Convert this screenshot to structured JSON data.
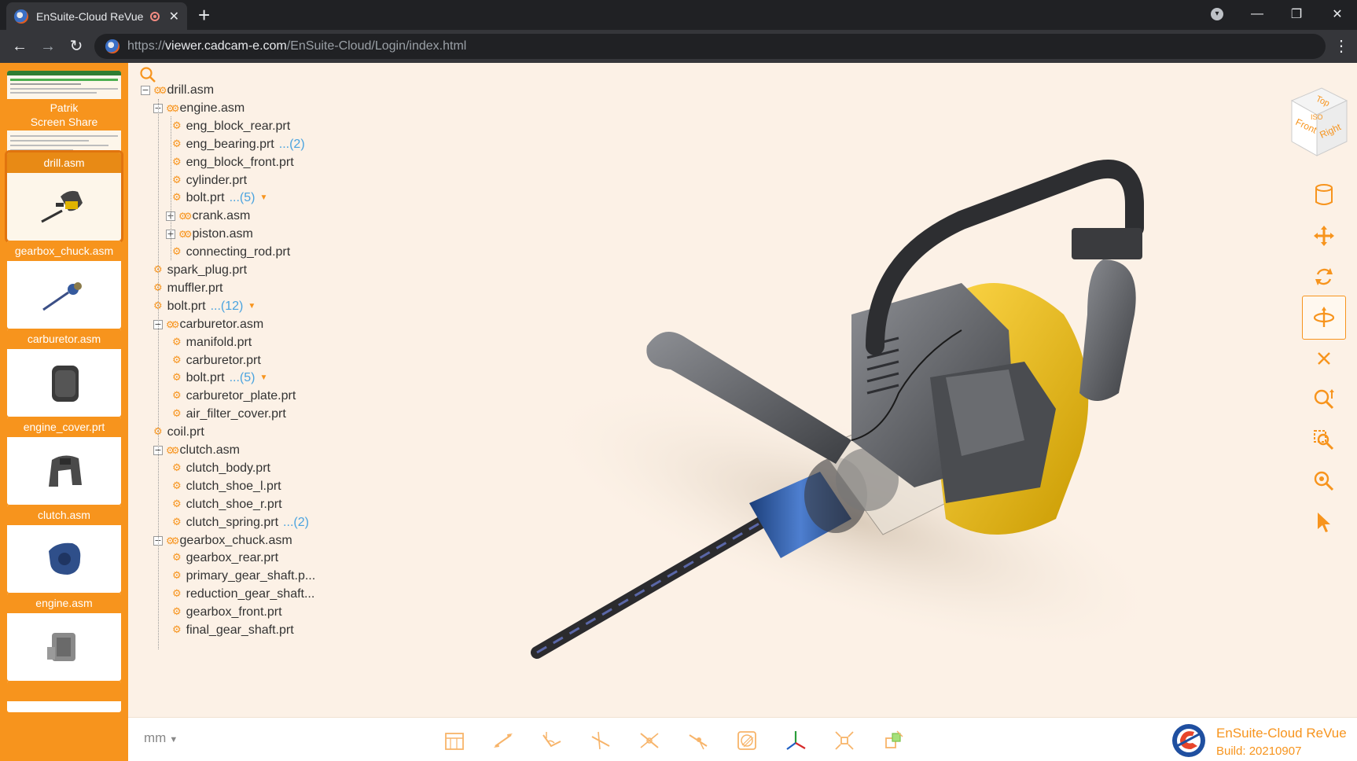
{
  "browser": {
    "tab_title": "EnSuite-Cloud ReVue",
    "url_scheme": "https://",
    "url_host": "viewer.cadcam-e.com",
    "url_path": "/EnSuite-Cloud/Login/index.html"
  },
  "sidebar": {
    "share": {
      "name": "Patrik",
      "caption": "Screen Share"
    },
    "thumbnails": [
      {
        "label": "drill.asm",
        "active": true
      },
      {
        "label": "gearbox_chuck.asm",
        "active": false
      },
      {
        "label": "carburetor.asm",
        "active": false
      },
      {
        "label": "engine_cover.prt",
        "active": false
      },
      {
        "label": "clutch.asm",
        "active": false
      },
      {
        "label": "engine.asm",
        "active": false
      }
    ]
  },
  "tree": {
    "nodes": [
      {
        "label": "drill.asm",
        "type": "asm",
        "level": 0,
        "expander": "−"
      },
      {
        "label": "engine.asm",
        "type": "asm",
        "level": 1,
        "expander": "−"
      },
      {
        "label": "eng_block_rear.prt",
        "type": "prt",
        "level": 2
      },
      {
        "label": "eng_bearing.prt",
        "type": "prt",
        "level": 2,
        "count": "...(2)"
      },
      {
        "label": "eng_block_front.prt",
        "type": "prt",
        "level": 2
      },
      {
        "label": "cylinder.prt",
        "type": "prt",
        "level": 2
      },
      {
        "label": "bolt.prt",
        "type": "prt",
        "level": 2,
        "count": "...(5)",
        "caret": true
      },
      {
        "label": "crank.asm",
        "type": "asm",
        "level": 2,
        "expander": "+"
      },
      {
        "label": "piston.asm",
        "type": "asm",
        "level": 2,
        "expander": "+"
      },
      {
        "label": "connecting_rod.prt",
        "type": "prt",
        "level": 2
      },
      {
        "label": "spark_plug.prt",
        "type": "prt",
        "level": 1
      },
      {
        "label": "muffler.prt",
        "type": "prt",
        "level": 1
      },
      {
        "label": "bolt.prt",
        "type": "prt",
        "level": 1,
        "count": "...(12)",
        "caret": true
      },
      {
        "label": "carburetor.asm",
        "type": "asm",
        "level": 1,
        "expander": "−"
      },
      {
        "label": "manifold.prt",
        "type": "prt",
        "level": 2
      },
      {
        "label": "carburetor.prt",
        "type": "prt",
        "level": 2
      },
      {
        "label": "bolt.prt",
        "type": "prt",
        "level": 2,
        "count": "...(5)",
        "caret": true
      },
      {
        "label": "carburetor_plate.prt",
        "type": "prt",
        "level": 2
      },
      {
        "label": "air_filter_cover.prt",
        "type": "prt",
        "level": 2
      },
      {
        "label": "coil.prt",
        "type": "prt",
        "level": 1
      },
      {
        "label": "clutch.asm",
        "type": "asm",
        "level": 1,
        "expander": "−"
      },
      {
        "label": "clutch_body.prt",
        "type": "prt",
        "level": 2
      },
      {
        "label": "clutch_shoe_l.prt",
        "type": "prt",
        "level": 2
      },
      {
        "label": "clutch_shoe_r.prt",
        "type": "prt",
        "level": 2
      },
      {
        "label": "clutch_spring.prt",
        "type": "prt",
        "level": 2,
        "count": "...(2)"
      },
      {
        "label": "gearbox_chuck.asm",
        "type": "asm",
        "level": 1,
        "expander": "−"
      },
      {
        "label": "gearbox_rear.prt",
        "type": "prt",
        "level": 2
      },
      {
        "label": "primary_gear_shaft.p...",
        "type": "prt",
        "level": 2
      },
      {
        "label": "reduction_gear_shaft...",
        "type": "prt",
        "level": 2
      },
      {
        "label": "gearbox_front.prt",
        "type": "prt",
        "level": 2
      },
      {
        "label": "final_gear_shaft.prt",
        "type": "prt",
        "level": 2
      }
    ]
  },
  "viewcube": {
    "top": "Top",
    "iso": "ISO",
    "front": "Front",
    "right": "Right"
  },
  "right_tools": [
    {
      "name": "database-icon"
    },
    {
      "name": "pan-icon"
    },
    {
      "name": "rotate-icon"
    },
    {
      "name": "orbit-icon",
      "active": true
    },
    {
      "name": "close-icon"
    },
    {
      "name": "zoom-fit-icon"
    },
    {
      "name": "zoom-window-icon"
    },
    {
      "name": "zoom-icon"
    },
    {
      "name": "select-cursor-icon"
    }
  ],
  "bottom": {
    "units": "mm",
    "tools": [
      "section-icon",
      "measure-distance-icon",
      "measure-angle-icon",
      "measure-edge-icon",
      "measure-radius-icon",
      "measure-point-icon",
      "cross-section-icon",
      "axis-triad-icon",
      "explode-icon",
      "transform-icon"
    ]
  },
  "brand": {
    "name": "EnSuite-Cloud ReVue",
    "build": "Build: 20210907"
  },
  "colors": {
    "accent": "#f7941d",
    "viewer_bg": "#fcf1e6",
    "count_blue": "#4aa3df"
  }
}
